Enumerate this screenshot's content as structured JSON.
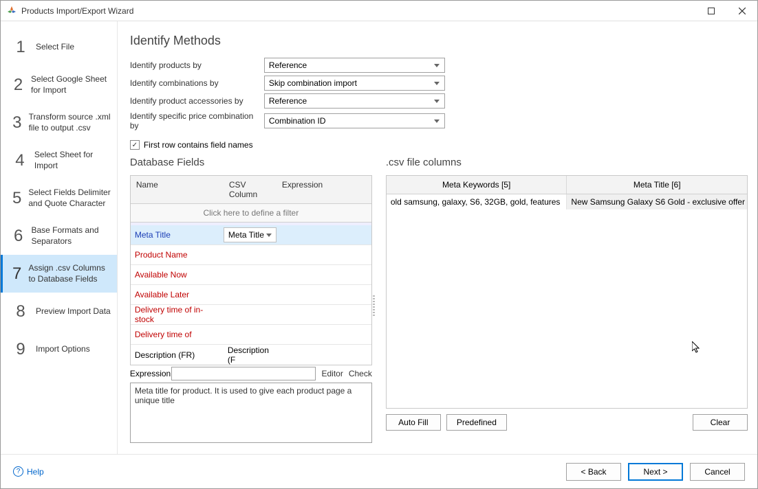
{
  "window": {
    "title": "Products Import/Export Wizard"
  },
  "steps": [
    {
      "num": "1",
      "label": "Select File"
    },
    {
      "num": "2",
      "label": "Select Google Sheet for Import"
    },
    {
      "num": "3",
      "label": "Transform source .xml file to output .csv"
    },
    {
      "num": "4",
      "label": "Select Sheet for Import"
    },
    {
      "num": "5",
      "label": "Select Fields Delimiter and Quote Character"
    },
    {
      "num": "6",
      "label": "Base Formats and Separators"
    },
    {
      "num": "7",
      "label": "Assign .csv Columns to Database Fields"
    },
    {
      "num": "8",
      "label": "Preview Import Data"
    },
    {
      "num": "9",
      "label": "Import Options"
    }
  ],
  "identify": {
    "heading": "Identify Methods",
    "rows": [
      {
        "label": "Identify products by",
        "value": "Reference"
      },
      {
        "label": "Identify combinations by",
        "value": "Skip combination import"
      },
      {
        "label": "Identify product accessories by",
        "value": "Reference"
      },
      {
        "label": "Identify specific price combination by",
        "value": "Combination ID"
      }
    ],
    "checkbox": {
      "checked": true,
      "label": "First row contains field names"
    }
  },
  "dbfields": {
    "heading": "Database Fields",
    "cols": {
      "name": "Name",
      "csv": "CSV Column",
      "expr": "Expression"
    },
    "filter": "Click here to define a filter",
    "rows": [
      {
        "name": "Meta Title",
        "csv": "Meta Title",
        "selected": true,
        "red": false
      },
      {
        "name": "Product Name",
        "csv": "",
        "selected": false,
        "red": true
      },
      {
        "name": "Available Now",
        "csv": "",
        "selected": false,
        "red": true
      },
      {
        "name": "Available Later",
        "csv": "",
        "selected": false,
        "red": true
      },
      {
        "name": "Delivery time of in-stock",
        "csv": "",
        "selected": false,
        "red": true
      },
      {
        "name": "Delivery time of",
        "csv": "",
        "selected": false,
        "red": true
      },
      {
        "name": "Description (FR)",
        "csv": "Description (F",
        "selected": false,
        "red": false
      }
    ],
    "expr_label": "Expression",
    "editor": "Editor",
    "check": "Check",
    "description": "Meta title for product. It is used to give each product page a unique title"
  },
  "csvcols": {
    "heading": ".csv file columns",
    "headers": [
      "Meta Keywords [5]",
      "Meta Title [6]"
    ],
    "row": [
      "old  samsung, galaxy, S6, 32GB, gold, features",
      "New Samsung Galaxy S6 Gold - exclusive offer"
    ],
    "buttons": {
      "autofill": "Auto Fill",
      "predefined": "Predefined",
      "clear": "Clear"
    }
  },
  "footer": {
    "help": "Help",
    "back": "< Back",
    "next": "Next >",
    "cancel": "Cancel"
  }
}
